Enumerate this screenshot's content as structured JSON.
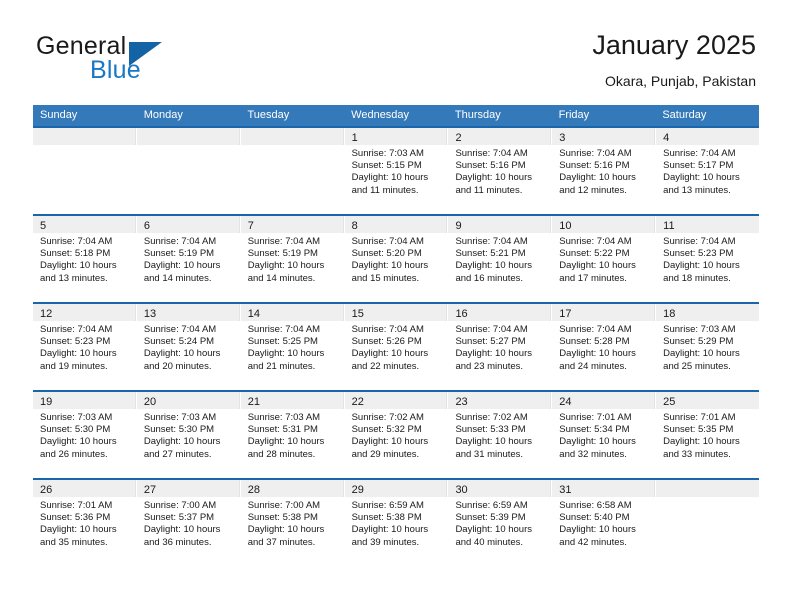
{
  "brand": {
    "general": "General",
    "blue": "Blue",
    "triangle_color": "#1464a5",
    "blue_color": "#1878c4"
  },
  "header": {
    "title": "January 2025",
    "location": "Okara, Punjab, Pakistan"
  },
  "colors": {
    "header_row_bg": "#3479b9",
    "week_separator": "#1a66ad",
    "day_band_bg": "#efefef",
    "text": "#1a1a1a"
  },
  "weekdays": [
    "Sunday",
    "Monday",
    "Tuesday",
    "Wednesday",
    "Thursday",
    "Friday",
    "Saturday"
  ],
  "weeks": [
    [
      {
        "day": "",
        "sunrise": "",
        "sunset": "",
        "daylight1": "",
        "daylight2": ""
      },
      {
        "day": "",
        "sunrise": "",
        "sunset": "",
        "daylight1": "",
        "daylight2": ""
      },
      {
        "day": "",
        "sunrise": "",
        "sunset": "",
        "daylight1": "",
        "daylight2": ""
      },
      {
        "day": "1",
        "sunrise": "Sunrise: 7:03 AM",
        "sunset": "Sunset: 5:15 PM",
        "daylight1": "Daylight: 10 hours",
        "daylight2": "and 11 minutes."
      },
      {
        "day": "2",
        "sunrise": "Sunrise: 7:04 AM",
        "sunset": "Sunset: 5:16 PM",
        "daylight1": "Daylight: 10 hours",
        "daylight2": "and 11 minutes."
      },
      {
        "day": "3",
        "sunrise": "Sunrise: 7:04 AM",
        "sunset": "Sunset: 5:16 PM",
        "daylight1": "Daylight: 10 hours",
        "daylight2": "and 12 minutes."
      },
      {
        "day": "4",
        "sunrise": "Sunrise: 7:04 AM",
        "sunset": "Sunset: 5:17 PM",
        "daylight1": "Daylight: 10 hours",
        "daylight2": "and 13 minutes."
      }
    ],
    [
      {
        "day": "5",
        "sunrise": "Sunrise: 7:04 AM",
        "sunset": "Sunset: 5:18 PM",
        "daylight1": "Daylight: 10 hours",
        "daylight2": "and 13 minutes."
      },
      {
        "day": "6",
        "sunrise": "Sunrise: 7:04 AM",
        "sunset": "Sunset: 5:19 PM",
        "daylight1": "Daylight: 10 hours",
        "daylight2": "and 14 minutes."
      },
      {
        "day": "7",
        "sunrise": "Sunrise: 7:04 AM",
        "sunset": "Sunset: 5:19 PM",
        "daylight1": "Daylight: 10 hours",
        "daylight2": "and 14 minutes."
      },
      {
        "day": "8",
        "sunrise": "Sunrise: 7:04 AM",
        "sunset": "Sunset: 5:20 PM",
        "daylight1": "Daylight: 10 hours",
        "daylight2": "and 15 minutes."
      },
      {
        "day": "9",
        "sunrise": "Sunrise: 7:04 AM",
        "sunset": "Sunset: 5:21 PM",
        "daylight1": "Daylight: 10 hours",
        "daylight2": "and 16 minutes."
      },
      {
        "day": "10",
        "sunrise": "Sunrise: 7:04 AM",
        "sunset": "Sunset: 5:22 PM",
        "daylight1": "Daylight: 10 hours",
        "daylight2": "and 17 minutes."
      },
      {
        "day": "11",
        "sunrise": "Sunrise: 7:04 AM",
        "sunset": "Sunset: 5:23 PM",
        "daylight1": "Daylight: 10 hours",
        "daylight2": "and 18 minutes."
      }
    ],
    [
      {
        "day": "12",
        "sunrise": "Sunrise: 7:04 AM",
        "sunset": "Sunset: 5:23 PM",
        "daylight1": "Daylight: 10 hours",
        "daylight2": "and 19 minutes."
      },
      {
        "day": "13",
        "sunrise": "Sunrise: 7:04 AM",
        "sunset": "Sunset: 5:24 PM",
        "daylight1": "Daylight: 10 hours",
        "daylight2": "and 20 minutes."
      },
      {
        "day": "14",
        "sunrise": "Sunrise: 7:04 AM",
        "sunset": "Sunset: 5:25 PM",
        "daylight1": "Daylight: 10 hours",
        "daylight2": "and 21 minutes."
      },
      {
        "day": "15",
        "sunrise": "Sunrise: 7:04 AM",
        "sunset": "Sunset: 5:26 PM",
        "daylight1": "Daylight: 10 hours",
        "daylight2": "and 22 minutes."
      },
      {
        "day": "16",
        "sunrise": "Sunrise: 7:04 AM",
        "sunset": "Sunset: 5:27 PM",
        "daylight1": "Daylight: 10 hours",
        "daylight2": "and 23 minutes."
      },
      {
        "day": "17",
        "sunrise": "Sunrise: 7:04 AM",
        "sunset": "Sunset: 5:28 PM",
        "daylight1": "Daylight: 10 hours",
        "daylight2": "and 24 minutes."
      },
      {
        "day": "18",
        "sunrise": "Sunrise: 7:03 AM",
        "sunset": "Sunset: 5:29 PM",
        "daylight1": "Daylight: 10 hours",
        "daylight2": "and 25 minutes."
      }
    ],
    [
      {
        "day": "19",
        "sunrise": "Sunrise: 7:03 AM",
        "sunset": "Sunset: 5:30 PM",
        "daylight1": "Daylight: 10 hours",
        "daylight2": "and 26 minutes."
      },
      {
        "day": "20",
        "sunrise": "Sunrise: 7:03 AM",
        "sunset": "Sunset: 5:30 PM",
        "daylight1": "Daylight: 10 hours",
        "daylight2": "and 27 minutes."
      },
      {
        "day": "21",
        "sunrise": "Sunrise: 7:03 AM",
        "sunset": "Sunset: 5:31 PM",
        "daylight1": "Daylight: 10 hours",
        "daylight2": "and 28 minutes."
      },
      {
        "day": "22",
        "sunrise": "Sunrise: 7:02 AM",
        "sunset": "Sunset: 5:32 PM",
        "daylight1": "Daylight: 10 hours",
        "daylight2": "and 29 minutes."
      },
      {
        "day": "23",
        "sunrise": "Sunrise: 7:02 AM",
        "sunset": "Sunset: 5:33 PM",
        "daylight1": "Daylight: 10 hours",
        "daylight2": "and 31 minutes."
      },
      {
        "day": "24",
        "sunrise": "Sunrise: 7:01 AM",
        "sunset": "Sunset: 5:34 PM",
        "daylight1": "Daylight: 10 hours",
        "daylight2": "and 32 minutes."
      },
      {
        "day": "25",
        "sunrise": "Sunrise: 7:01 AM",
        "sunset": "Sunset: 5:35 PM",
        "daylight1": "Daylight: 10 hours",
        "daylight2": "and 33 minutes."
      }
    ],
    [
      {
        "day": "26",
        "sunrise": "Sunrise: 7:01 AM",
        "sunset": "Sunset: 5:36 PM",
        "daylight1": "Daylight: 10 hours",
        "daylight2": "and 35 minutes."
      },
      {
        "day": "27",
        "sunrise": "Sunrise: 7:00 AM",
        "sunset": "Sunset: 5:37 PM",
        "daylight1": "Daylight: 10 hours",
        "daylight2": "and 36 minutes."
      },
      {
        "day": "28",
        "sunrise": "Sunrise: 7:00 AM",
        "sunset": "Sunset: 5:38 PM",
        "daylight1": "Daylight: 10 hours",
        "daylight2": "and 37 minutes."
      },
      {
        "day": "29",
        "sunrise": "Sunrise: 6:59 AM",
        "sunset": "Sunset: 5:38 PM",
        "daylight1": "Daylight: 10 hours",
        "daylight2": "and 39 minutes."
      },
      {
        "day": "30",
        "sunrise": "Sunrise: 6:59 AM",
        "sunset": "Sunset: 5:39 PM",
        "daylight1": "Daylight: 10 hours",
        "daylight2": "and 40 minutes."
      },
      {
        "day": "31",
        "sunrise": "Sunrise: 6:58 AM",
        "sunset": "Sunset: 5:40 PM",
        "daylight1": "Daylight: 10 hours",
        "daylight2": "and 42 minutes."
      },
      {
        "day": "",
        "sunrise": "",
        "sunset": "",
        "daylight1": "",
        "daylight2": ""
      }
    ]
  ]
}
